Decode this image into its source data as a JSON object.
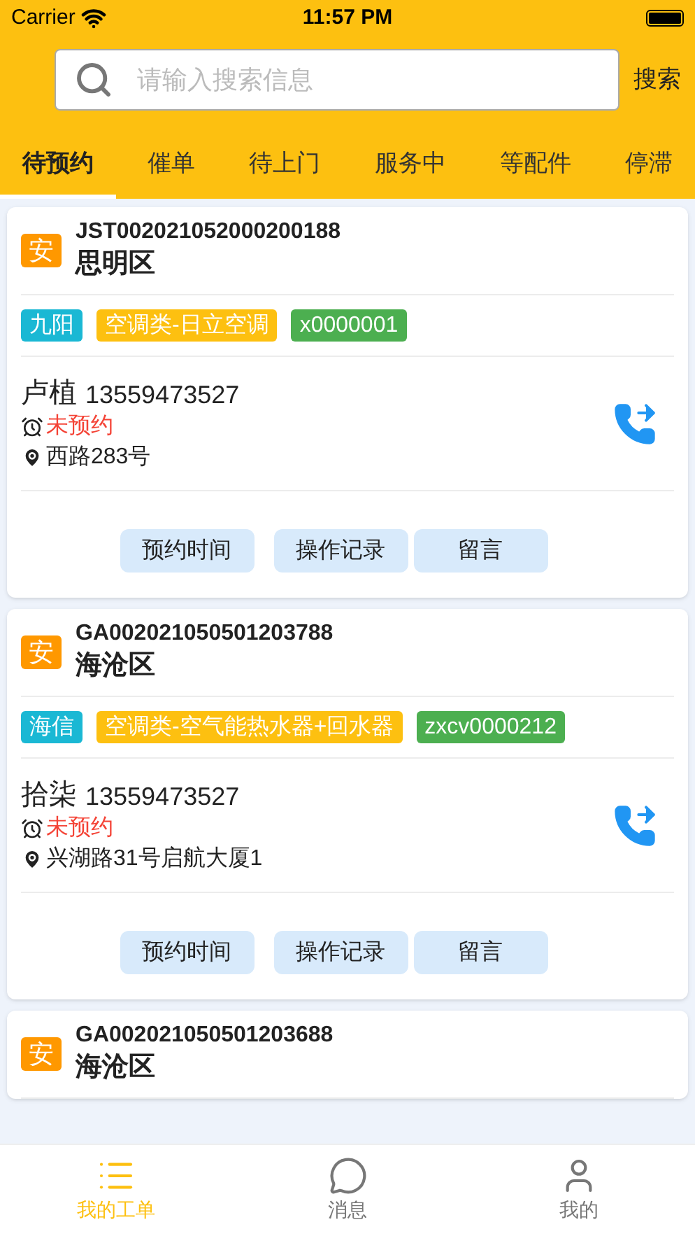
{
  "status_bar": {
    "carrier": "Carrier",
    "time": "11:57 PM"
  },
  "search": {
    "placeholder": "请输入搜索信息",
    "button": "搜索"
  },
  "tabs": [
    {
      "label": "待预约",
      "selected": true
    },
    {
      "label": "催单",
      "selected": false
    },
    {
      "label": "待上门",
      "selected": false
    },
    {
      "label": "服务中",
      "selected": false
    },
    {
      "label": "等配件",
      "selected": false
    },
    {
      "label": "停滞",
      "selected": false
    }
  ],
  "orders": [
    {
      "badge": "安",
      "order_no": "JST002021052000200188",
      "district": "思明区",
      "tags": [
        {
          "label": "九阳",
          "color": "#1ab8d4"
        },
        {
          "label": "空调类-日立空调",
          "color": "#fdc010"
        },
        {
          "label": "x0000001",
          "color": "#4caf50"
        }
      ],
      "name": "卢植",
      "phone": "13559473527",
      "status": "未预约",
      "address": "西路283号",
      "actions": [
        "预约时间",
        "操作记录",
        "留言"
      ]
    },
    {
      "badge": "安",
      "order_no": "GA002021050501203788",
      "district": "海沧区",
      "tags": [
        {
          "label": "海信",
          "color": "#1ab8d4"
        },
        {
          "label": "空调类-空气能热水器+回水器",
          "color": "#fdc010"
        },
        {
          "label": "zxcv0000212",
          "color": "#4caf50"
        }
      ],
      "name": "拾柒",
      "phone": "13559473527",
      "status": "未预约",
      "address": "兴湖路31号启航大厦1",
      "actions": [
        "预约时间",
        "操作记录",
        "留言"
      ]
    },
    {
      "badge": "安",
      "order_no": "GA002021050501203688",
      "district": "海沧区"
    }
  ],
  "bottom_tabs": [
    {
      "label": "我的工单",
      "kind": "list",
      "selected": true
    },
    {
      "label": "消息",
      "kind": "chat",
      "selected": false
    },
    {
      "label": "我的",
      "kind": "user",
      "selected": false
    }
  ]
}
